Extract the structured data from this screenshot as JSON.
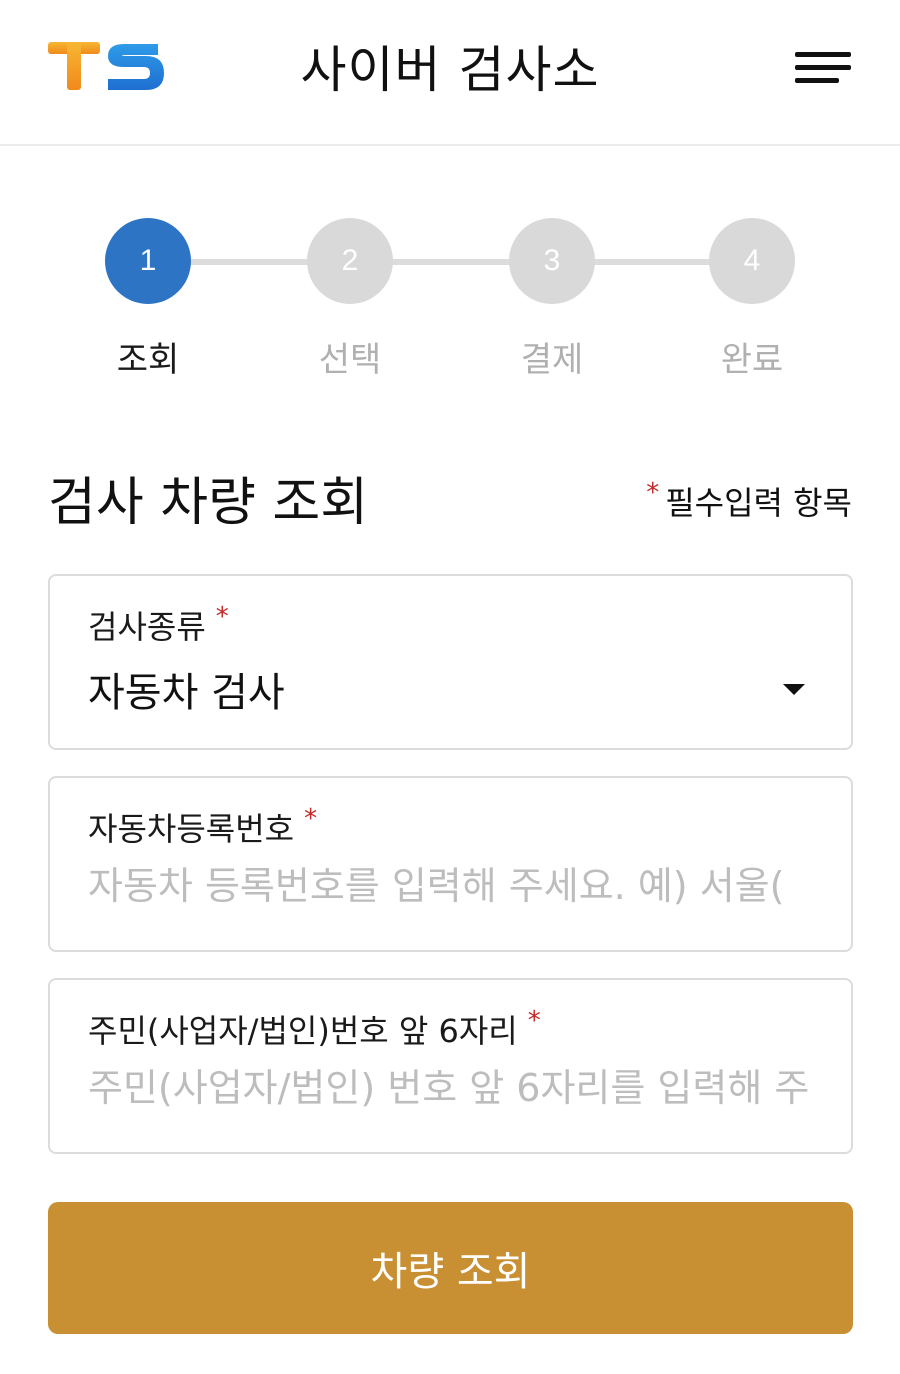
{
  "header": {
    "logo_text": "TS",
    "title": "사이버 검사소"
  },
  "colors": {
    "accent": "#2d74c4",
    "button": "#c98f33",
    "required": "#c62828",
    "inactive_step": "#d9d9d9"
  },
  "stepper": {
    "steps": [
      {
        "number": "1",
        "label": "조회",
        "active": true
      },
      {
        "number": "2",
        "label": "선택",
        "active": false
      },
      {
        "number": "3",
        "label": "결제",
        "active": false
      },
      {
        "number": "4",
        "label": "완료",
        "active": false
      }
    ]
  },
  "section": {
    "title": "검사 차량 조회",
    "required_mark": "*",
    "required_note": "필수입력 항목"
  },
  "form": {
    "inspection_type": {
      "label": "검사종류",
      "value": "자동차 검사",
      "required_mark": "*"
    },
    "vehicle_number": {
      "label": "자동차등록번호",
      "placeholder": "자동차 등록번호를 입력해 주세요. 예) 서울(",
      "required_mark": "*"
    },
    "resident_number": {
      "label": "주민(사업자/법인)번호 앞 6자리",
      "placeholder": "주민(사업자/법인) 번호 앞 6자리를 입력해 주",
      "required_mark": "*"
    }
  },
  "submit": {
    "label": "차량 조회"
  }
}
